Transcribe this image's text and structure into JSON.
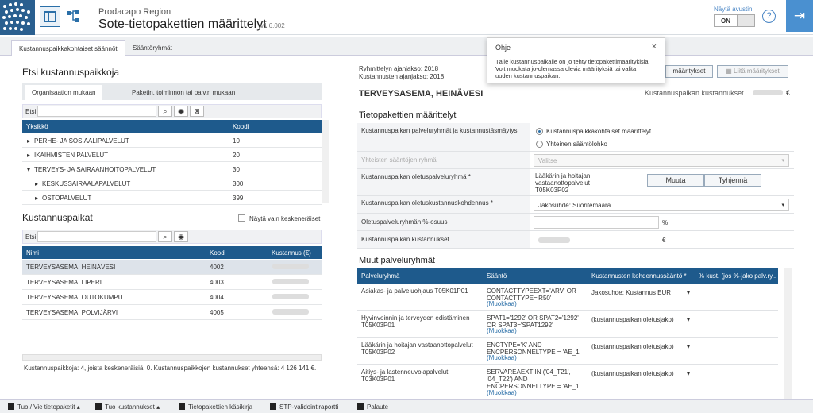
{
  "header": {
    "org": "Prodacapo Region",
    "title": "Sote-tietopakettien määrittelyt",
    "version": "v1.6.002",
    "assistant_label": "Näytä avustin",
    "toggle_value": "ON"
  },
  "tabs": [
    "Kustannuspaikkakohtaiset säännöt",
    "Sääntöryhmät"
  ],
  "left": {
    "find_title": "Etsi kustannuspaikkoja",
    "subtabs": [
      "Organisaation mukaan",
      "Paketin, toiminnon tai palv.r. mukaan"
    ],
    "search_label": "Etsi",
    "org_table": {
      "headers": [
        "Yksikkö",
        "Koodi"
      ],
      "rows": [
        {
          "name": "PERHE- JA SOSIAALIPALVELUT",
          "code": "10",
          "arrow": "▸"
        },
        {
          "name": "IKÄIHMISTEN PALVELUT",
          "code": "20",
          "arrow": "▸"
        },
        {
          "name": "TERVEYS- JA SAIRAANHOITOPALVELUT",
          "code": "30",
          "arrow": "▾"
        },
        {
          "name": "KESKUSSAIRAALAPALVELUT",
          "code": "300",
          "arrow": "▸"
        },
        {
          "name": "OSTOPALVELUT",
          "code": "399",
          "arrow": "▸"
        }
      ]
    },
    "kp_title": "Kustannuspaikat",
    "only_incomplete": "Näytä vain keskeneräiset",
    "kp_search_label": "Etsi",
    "kp_table": {
      "headers": [
        "Nimi",
        "Koodi",
        "Kustannus (€)"
      ],
      "rows": [
        {
          "name": "TERVEYSASEMA, HEINÄVESI",
          "code": "4002"
        },
        {
          "name": "TERVEYSASEMA, LIPERI",
          "code": "4003"
        },
        {
          "name": "TERVEYSASEMA, OUTOKUMPU",
          "code": "4004"
        },
        {
          "name": "TERVEYSASEMA, POLVIJÄRVI",
          "code": "4005"
        }
      ]
    },
    "summary": "Kustannuspaikkoja: 4, joista keskeneräisiä: 0. Kustannuspaikkojen kustannukset yhteensä: 4 126 141 €."
  },
  "right": {
    "period_group": "Ryhmittelyn ajanjakso: 2018",
    "period_cost": "Kustannusten ajanjakso: 2018",
    "copy_btn": "määritykset",
    "paste_btn": "Liitä määritykset",
    "cost_center": "TERVEYSASEMA, HEINÄVESI",
    "cost_label": "Kustannuspaikan kustannukset",
    "euro": "€",
    "defs_title": "Tietopakettien määrittelyt",
    "f_groups": "Kustannuspaikan palveluryhmät ja kustannustäsmäytys",
    "opt1": "Kustannuspaikkakohtaiset määrittelyt",
    "opt2": "Yhteinen sääntölohko",
    "f_common": "Yhteisten sääntöjen ryhmä",
    "common_value": "Valitse",
    "f_default_group": "Kustannuspaikan oletuspalveluryhmä *",
    "default_group_value": "Lääkärin ja hoitajan vastaanottopalvelut T05K03P02",
    "btn_change": "Muuta",
    "btn_clear": "Tyhjennä",
    "f_alloc": "Kustannuspaikan oletuskustannuskohdennus *",
    "alloc_value": "Jakosuhde: Suoritemäärä",
    "f_share": "Oletuspalveluryhmän %-osuus",
    "pct": "%",
    "f_costs": "Kustannuspaikan kustannukset",
    "other_title": "Muut palveluryhmät",
    "grid": {
      "headers": [
        "Palveluryhmä",
        "Sääntö",
        "Kustannusten kohdennussääntö *",
        "% kust. (jos %-jako palv.ry..."
      ],
      "rows": [
        {
          "group": "Asiakas- ja palveluohjaus T05K01P01",
          "rule": "CONTACTTYPEEXT='ARV' OR CONTACTTYPE='R50'",
          "edit": "(Muokkaa)",
          "alloc": "Jakosuhde: Kustannus EUR"
        },
        {
          "group": "Hyvinvoinnin ja terveyden edistäminen T05K03P01",
          "rule": "SPAT1='1292' OR SPAT2='1292' OR SPAT3='SPAT1292'",
          "edit": "(Muokkaa)",
          "alloc": "(kustannuspaikan oletusjako)"
        },
        {
          "group": "Lääkärin ja hoitajan vastaanottopalvelut T05K03P02",
          "rule": "ENCTYPE='K' AND ENCPERSONNELTYPE = 'AE_1'",
          "edit": "(Muokkaa)",
          "alloc": "(kustannuspaikan oletusjako)"
        },
        {
          "group": "Äitiys- ja lastenneuvolapalvelut T03K03P01",
          "rule": "SERVAREAEXT IN ('04_T21', '04_T22') AND ENCPERSONNELTYPE = 'AE_1'",
          "edit": "(Muokkaa)",
          "alloc": "(kustannuspaikan oletusjako)"
        }
      ]
    }
  },
  "tooltip": {
    "title": "Ohje",
    "close": "×",
    "body": "Tälle kustannuspaikalle on jo tehty tietopakettimääritykisiä. Voit muokata jo-olemassa olevia määrityksiä tai valita uuden kustannuspaikan."
  },
  "bottombar": [
    "Tuo / Vie tietopaketit",
    "Tuo kustannukset",
    "Tietopakettien käsikirja",
    "STP-validointiraportti",
    "Palaute"
  ]
}
